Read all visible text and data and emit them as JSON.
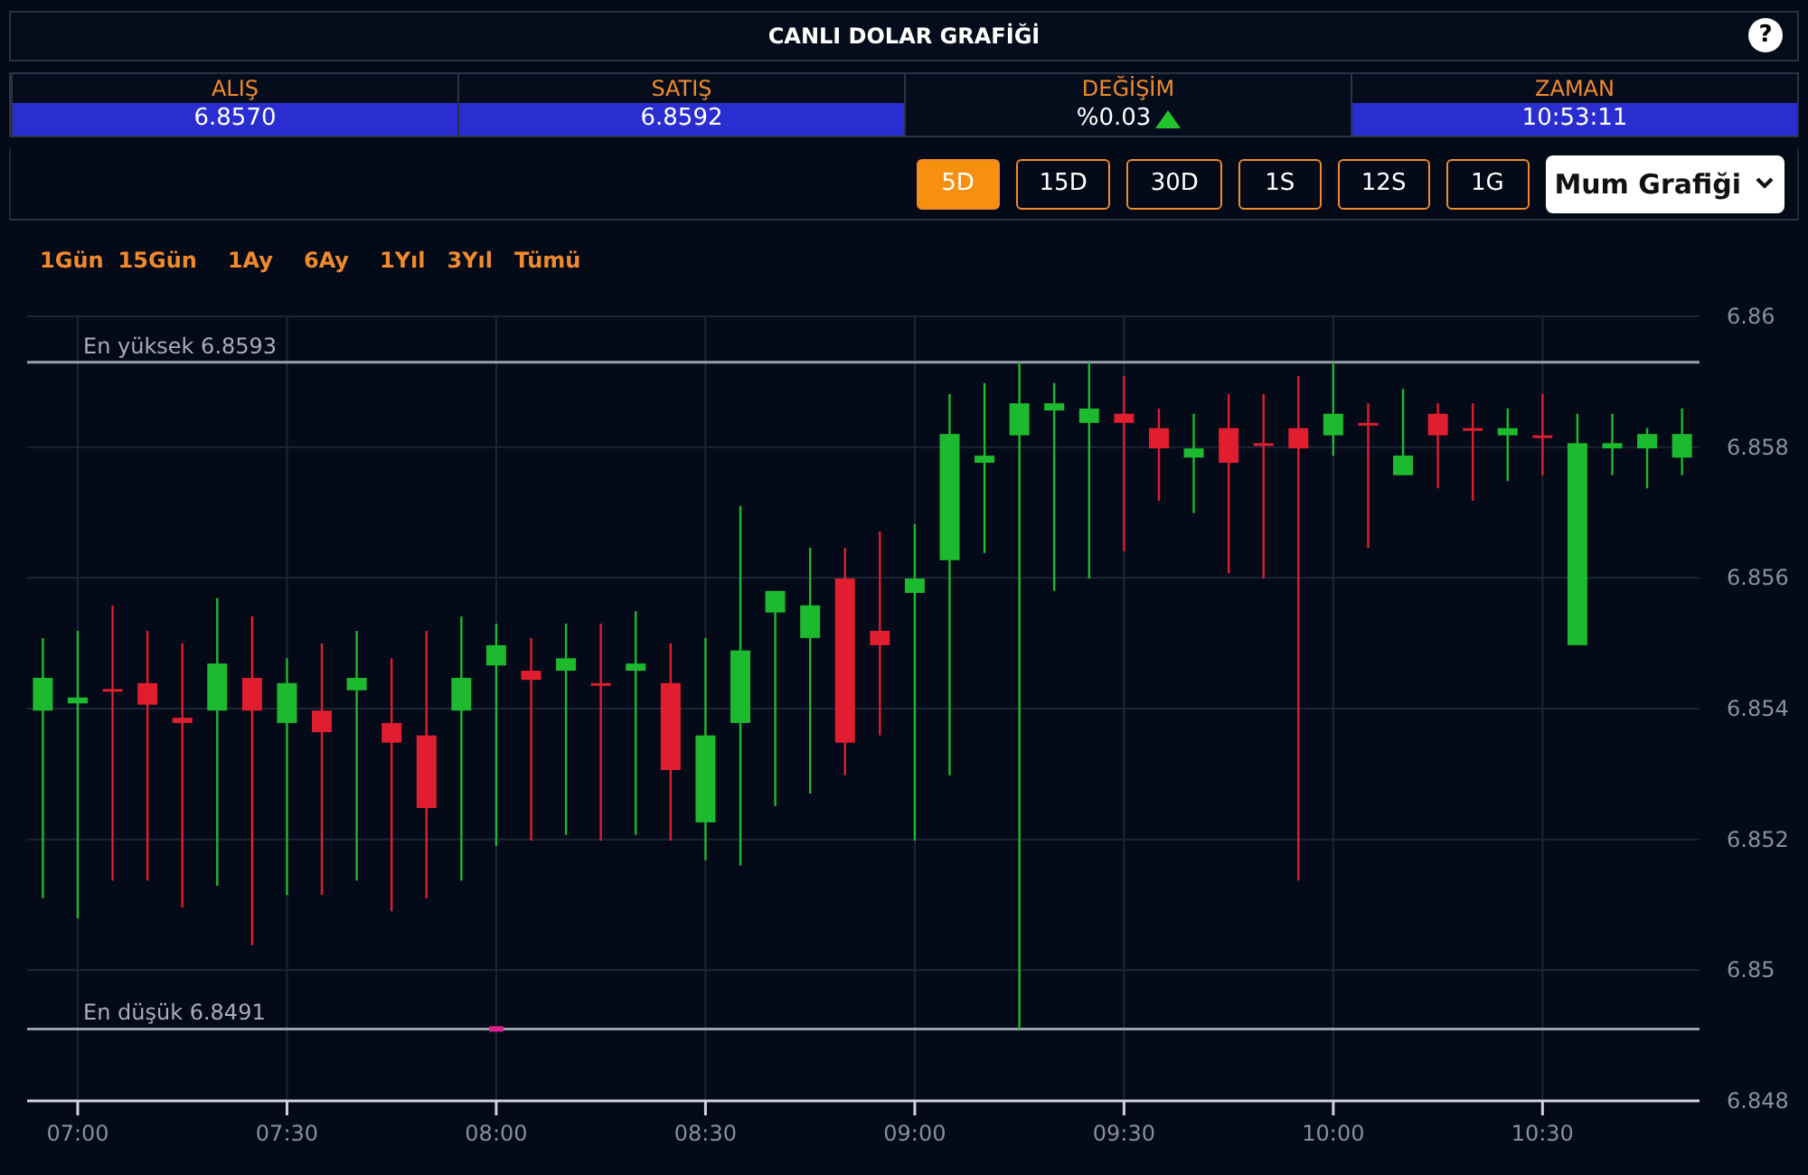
{
  "title_bar": {
    "title": "CANLI DOLAR GRAFİĞİ",
    "help": "?"
  },
  "quotes": [
    {
      "kind": "plain",
      "label": "ALIŞ",
      "value": "6.8570"
    },
    {
      "kind": "plain",
      "label": "SATIŞ",
      "value": "6.8592"
    },
    {
      "kind": "rise",
      "label": "DEĞİŞİM",
      "value": "%0.03"
    },
    {
      "kind": "plain",
      "label": "ZAMAN",
      "value": "10:53:11"
    }
  ],
  "intervals": [
    {
      "label": "5D",
      "selected": true
    },
    {
      "label": "15D",
      "selected": false
    },
    {
      "label": "30D",
      "selected": false
    },
    {
      "label": "1S",
      "selected": false
    },
    {
      "label": "12S",
      "selected": false
    },
    {
      "label": "1G",
      "selected": false
    }
  ],
  "chart_type_select": {
    "value": "Mum Grafiği"
  },
  "zoom_links": [
    "1Gün",
    "15Gün",
    "1Ay",
    "6Ay",
    "1Yıl",
    "3Yıl",
    "Tümü"
  ],
  "chart": {
    "chart_data": {
      "type": "candlestick",
      "categories": [
        null,
        "07:00",
        null,
        null,
        null,
        null,
        null,
        "07:30",
        null,
        null,
        null,
        null,
        null,
        "08:00",
        null,
        null,
        null,
        null,
        null,
        "08:30",
        null,
        null,
        null,
        null,
        null,
        "09:00",
        null,
        null,
        null,
        null,
        null,
        "09:30",
        null,
        null,
        null,
        null,
        null,
        "10:00",
        null,
        null,
        null,
        null,
        null,
        "10:30",
        null,
        null,
        null,
        null
      ],
      "ohlc": [
        [
          6.85397,
          6.85508,
          6.8511,
          6.85447
        ],
        [
          6.85408,
          6.85519,
          6.85079,
          6.85417
        ],
        [
          6.8543,
          6.85558,
          6.85137,
          6.8543
        ],
        [
          6.85439,
          6.85519,
          6.85137,
          6.85406
        ],
        [
          6.85386,
          6.855,
          6.85096,
          6.85378
        ],
        [
          6.85397,
          6.85569,
          6.85129,
          6.85469
        ],
        [
          6.85447,
          6.85541,
          6.85038,
          6.85397
        ],
        [
          6.85378,
          6.85477,
          6.85115,
          6.85439
        ],
        [
          6.85397,
          6.855,
          6.85115,
          6.85364
        ],
        [
          6.85428,
          6.85519,
          6.85137,
          6.85447
        ],
        [
          6.85378,
          6.85477,
          6.8509,
          6.85348
        ],
        [
          6.85359,
          6.85519,
          6.8511,
          6.85248
        ],
        [
          6.85397,
          6.85541,
          6.85137,
          6.85447
        ],
        [
          6.85466,
          6.8553,
          6.8519,
          6.85497
        ],
        [
          6.85458,
          6.85508,
          6.85198,
          6.85444
        ],
        [
          6.85458,
          6.8553,
          6.85207,
          6.85477
        ],
        [
          6.85439,
          6.8553,
          6.85198,
          6.85439
        ],
        [
          6.85458,
          6.85549,
          6.85207,
          6.85469
        ],
        [
          6.85439,
          6.855,
          6.85198,
          6.85306
        ],
        [
          6.85226,
          6.85508,
          6.85168,
          6.85359
        ],
        [
          6.85378,
          6.8571,
          6.8516,
          6.85489
        ],
        [
          6.85547,
          6.8558,
          6.85251,
          6.8558
        ],
        [
          6.85508,
          6.85646,
          6.8527,
          6.85558
        ],
        [
          6.85599,
          6.85646,
          6.85298,
          6.85348
        ],
        [
          6.85519,
          6.85671,
          6.85359,
          6.85497
        ],
        [
          6.85577,
          6.85682,
          6.85198,
          6.85599
        ],
        [
          6.85627,
          6.85881,
          6.85298,
          6.8582
        ],
        [
          6.85776,
          6.85898,
          6.85638,
          6.85787
        ],
        [
          6.85818,
          6.8593,
          6.8491,
          6.85867
        ],
        [
          6.85856,
          6.85898,
          6.8558,
          6.85867
        ],
        [
          6.85837,
          6.8593,
          6.85599,
          6.85859
        ],
        [
          6.85851,
          6.85909,
          6.85641,
          6.85837
        ],
        [
          6.85829,
          6.85859,
          6.85718,
          6.85798
        ],
        [
          6.85784,
          6.85851,
          6.85699,
          6.85798
        ],
        [
          6.85829,
          6.85881,
          6.85607,
          6.85776
        ],
        [
          6.85806,
          6.85881,
          6.85599,
          6.85806
        ],
        [
          6.85829,
          6.85909,
          6.85137,
          6.85798
        ],
        [
          6.85818,
          6.8593,
          6.85787,
          6.85851
        ],
        [
          6.85837,
          6.85867,
          6.85646,
          6.85837
        ],
        [
          6.85757,
          6.85889,
          6.85757,
          6.85787
        ],
        [
          6.85851,
          6.85867,
          6.85737,
          6.85818
        ],
        [
          6.85829,
          6.85867,
          6.85718,
          6.85829
        ],
        [
          6.85818,
          6.85859,
          6.85748,
          6.85829
        ],
        [
          6.85818,
          6.85881,
          6.85757,
          6.85818
        ],
        [
          6.85497,
          6.85851,
          6.85497,
          6.85806
        ],
        [
          6.85798,
          6.85851,
          6.85757,
          6.85806
        ],
        [
          6.85798,
          6.85829,
          6.85737,
          6.8582
        ],
        [
          6.85784,
          6.85859,
          6.85757,
          6.8582
        ]
      ],
      "ylim": [
        6.848,
        6.86
      ],
      "yticks": [
        6.848,
        6.85,
        6.852,
        6.854,
        6.856,
        6.858,
        6.86
      ],
      "grid": true,
      "ref_lines": [
        {
          "axis": "y",
          "value": 6.8593,
          "label": "En yüksek 6.8593"
        },
        {
          "axis": "y",
          "value": 6.8491,
          "label": "En düşük 6.8491"
        }
      ],
      "annotations": [
        {
          "x": "08:00"
        }
      ]
    }
  }
}
